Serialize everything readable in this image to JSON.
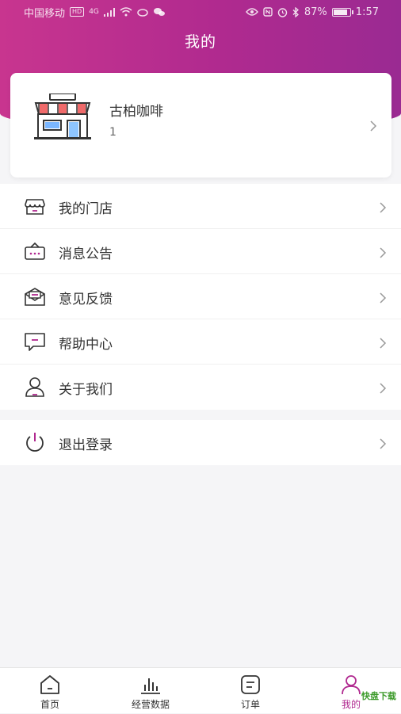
{
  "status_bar": {
    "carrier": "中国移动",
    "hd_badge": "HD",
    "network": "4G",
    "battery": "87%",
    "battery_level": 0.87,
    "time": "1:57"
  },
  "header": {
    "title": "我的"
  },
  "store": {
    "name": "古柏咖啡",
    "id": "1"
  },
  "menu": [
    {
      "label": "我的门店",
      "icon": "storefront-icon"
    },
    {
      "label": "消息公告",
      "icon": "message-box-icon"
    },
    {
      "label": "意见反馈",
      "icon": "feedback-envelope-icon"
    },
    {
      "label": "帮助中心",
      "icon": "help-chat-icon"
    },
    {
      "label": "关于我们",
      "icon": "user-icon"
    }
  ],
  "logout": {
    "label": "退出登录",
    "icon": "power-icon"
  },
  "tabbar": [
    {
      "label": "首页",
      "icon": "home-icon"
    },
    {
      "label": "经营数据",
      "icon": "bar-chart-icon"
    },
    {
      "label": "订单",
      "icon": "order-list-icon"
    },
    {
      "label": "我的",
      "icon": "profile-icon"
    }
  ],
  "watermark": "快盘下载",
  "colors": {
    "header_start": "#c8358f",
    "header_end": "#9a2a92",
    "accent": "#b0288f",
    "icon": "#333333"
  }
}
